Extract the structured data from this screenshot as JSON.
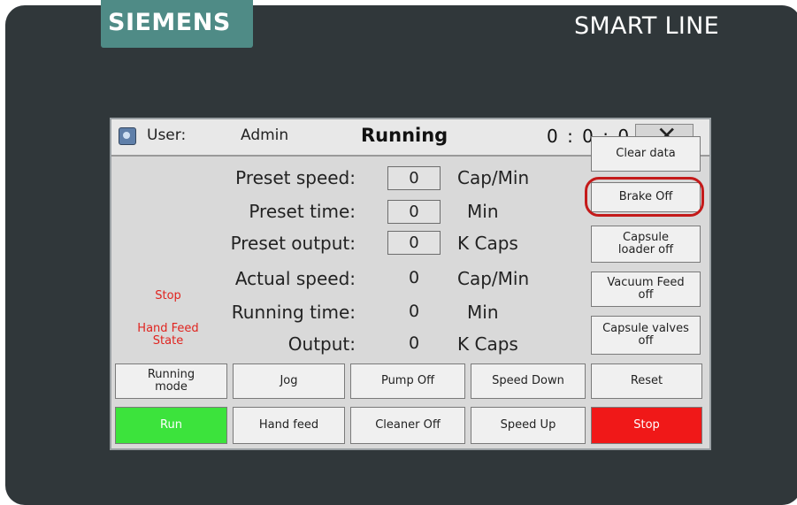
{
  "brand": {
    "left": "SIEMENS",
    "right": "SMART LINE"
  },
  "titlebar": {
    "user_label": "User:",
    "user_value": "Admin",
    "state": "Running",
    "clock": "0 : 0 : 0"
  },
  "params": [
    {
      "label": "Preset speed:",
      "value": "0",
      "unit": "Cap/Min",
      "editable": true
    },
    {
      "label": "Preset time:",
      "value": "0",
      "unit": "Min",
      "editable": true
    },
    {
      "label": "Preset output:",
      "value": "0",
      "unit": "K Caps",
      "editable": true
    },
    {
      "label": "Actual speed:",
      "value": "0",
      "unit": "Cap/Min",
      "editable": false
    },
    {
      "label": "Running time:",
      "value": "0",
      "unit": "Min",
      "editable": false
    },
    {
      "label": "Output:",
      "value": "0",
      "unit": "K Caps",
      "editable": false
    }
  ],
  "status": {
    "stop": "Stop",
    "hand_feed_1": "Hand Feed",
    "hand_feed_2": "State"
  },
  "side_buttons": {
    "clear": "Clear data",
    "brake": "Brake Off",
    "capsule_loader_1": "Capsule",
    "capsule_loader_2": "loader off",
    "vacuum_1": "Vacuum Feed",
    "vacuum_2": "off",
    "valves_1": "Capsule valves",
    "valves_2": "off"
  },
  "bottom_buttons": {
    "running_mode_1": "Running",
    "running_mode_2": "mode",
    "jog": "Jog",
    "pump": "Pump Off",
    "speed_down": "Speed Down",
    "reset": "Reset",
    "run": "Run",
    "hand_feed": "Hand feed",
    "cleaner": "Cleaner Off",
    "speed_up": "Speed Up",
    "stop": "Stop"
  },
  "colors": {
    "run": "#3ce33c",
    "stop": "#f01818",
    "highlight": "#c41a1a",
    "brand": "#4f8b86"
  }
}
